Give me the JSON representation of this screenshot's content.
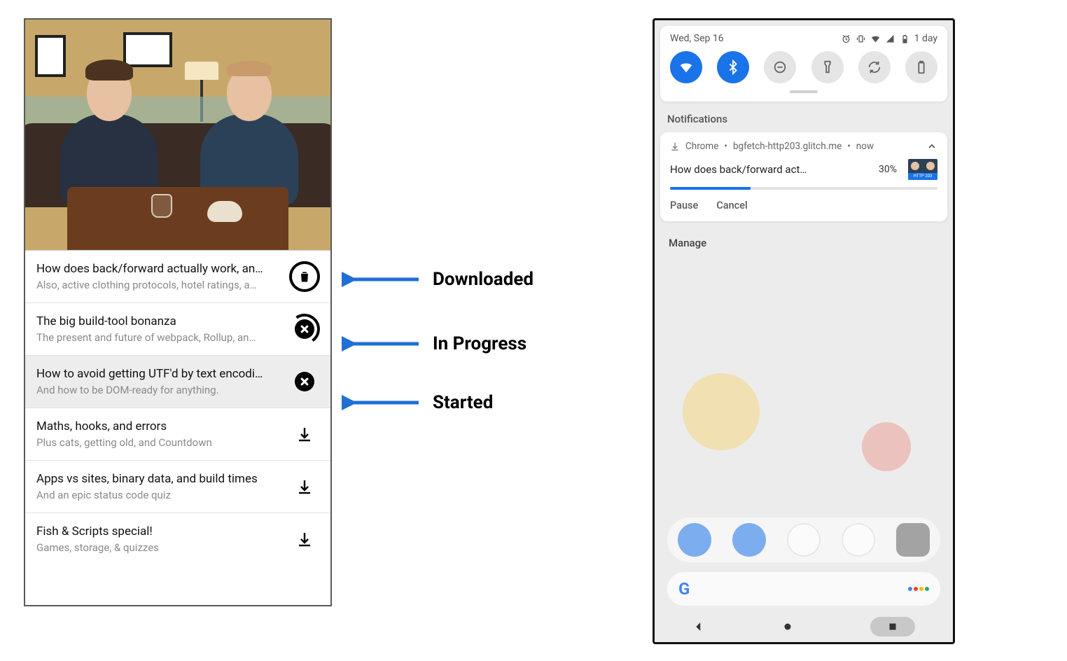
{
  "left": {
    "items": [
      {
        "title": "How does back/forward actually work, an…",
        "sub": "Also, active clothing protocols, hotel ratings, a…",
        "state": "downloaded"
      },
      {
        "title": "The big build-tool bonanza",
        "sub": "The present and future of webpack, Rollup, an…",
        "state": "inprogress"
      },
      {
        "title": "How to avoid getting UTF'd by text encodi…",
        "sub": "And how to be DOM-ready for anything.",
        "state": "started",
        "highlight": true
      },
      {
        "title": "Maths, hooks, and errors",
        "sub": "Plus cats, getting old, and Countdown",
        "state": "idle"
      },
      {
        "title": "Apps vs sites, binary data, and build times",
        "sub": "And an epic status code quiz",
        "state": "idle"
      },
      {
        "title": "Fish & Scripts special!",
        "sub": "Games, storage, & quizzes",
        "state": "idle"
      }
    ]
  },
  "annot": {
    "downloaded": "Downloaded",
    "inprogress": "In Progress",
    "started": "Started"
  },
  "phone": {
    "date": "Wed, Sep 16",
    "battery_text": "1 day",
    "notif_section": "Notifications",
    "manage": "Manage",
    "notification": {
      "app": "Chrome",
      "source": "bgfetch-http203.glitch.me",
      "time": "now",
      "title": "How does back/forward act…",
      "percent": "30%",
      "progress_pct": 30,
      "thumb_label": "HTTP 203",
      "actions": {
        "pause": "Pause",
        "cancel": "Cancel"
      }
    }
  }
}
